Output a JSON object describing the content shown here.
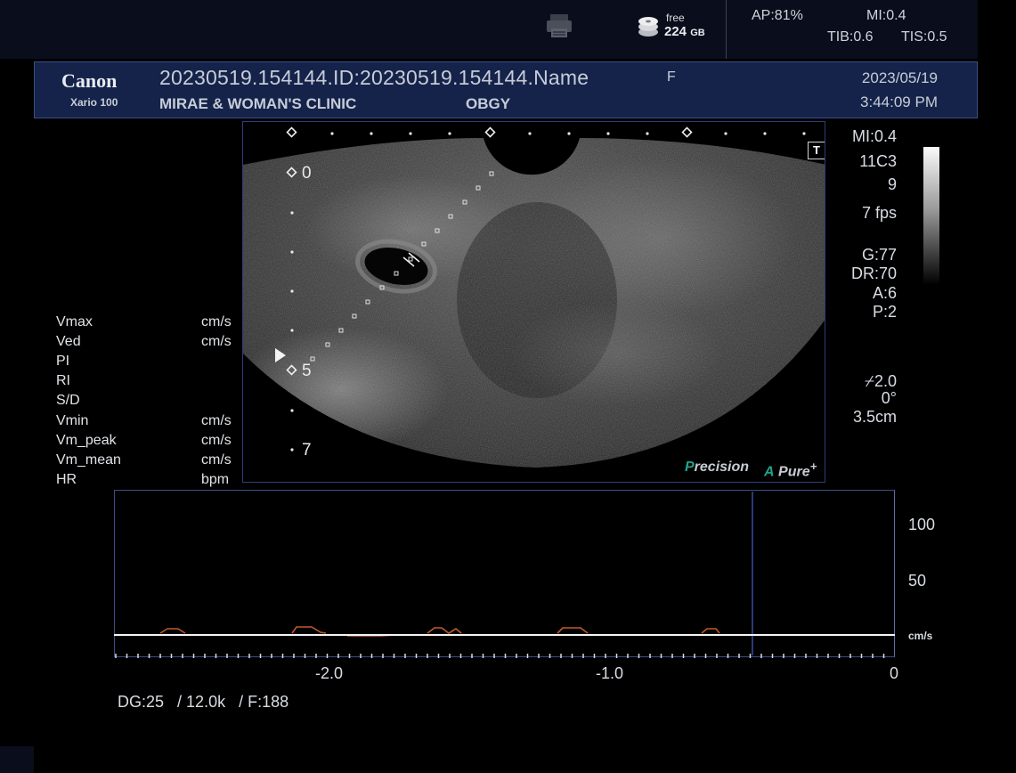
{
  "status": {
    "free_label": "free",
    "free_value": "224",
    "free_unit": "GB",
    "ap": "AP:81%",
    "mi": "MI:0.4",
    "tib": "TIB:0.6",
    "tis": "TIS:0.5",
    "printer_icon": "printer-icon",
    "disk_icon": "disk-icon"
  },
  "header": {
    "brand": "Canon",
    "model": "Xario 100",
    "patient_id": "20230519.154144.ID:20230519.154144.Name",
    "sex": "F",
    "clinic": "MIRAE & WOMAN'S CLINIC",
    "department": "OBGY",
    "date": "2023/05/19",
    "time": "3:44:09 PM"
  },
  "image": {
    "depth_labels": [
      "0",
      "5",
      "7"
    ],
    "t_marker": "T",
    "precision_prefix": "P",
    "precision_rest": "recision",
    "pure_prefix": "A",
    "pure_rest": "Pure",
    "pure_suffix": "+"
  },
  "right_params": {
    "mi": "MI:0.4",
    "probe": "11C3",
    "freq": "9",
    "fps": "7 fps",
    "gain": "G:77",
    "dr": "DR:70",
    "a": "A:6",
    "p": "P:2",
    "angle": "2.0",
    "angle_deg": "0°",
    "depth": "3.5cm"
  },
  "measurements": [
    {
      "label": "Vmax",
      "unit": "cm/s"
    },
    {
      "label": "Ved",
      "unit": "cm/s"
    },
    {
      "label": "PI",
      "unit": ""
    },
    {
      "label": "RI",
      "unit": ""
    },
    {
      "label": "S/D",
      "unit": ""
    },
    {
      "label": "Vmin",
      "unit": "cm/s"
    },
    {
      "label": "Vm_peak",
      "unit": "cm/s"
    },
    {
      "label": "Vm_mean",
      "unit": "cm/s"
    },
    {
      "label": "HR",
      "unit": "bpm"
    }
  ],
  "doppler": {
    "y_ticks": [
      "100",
      "50"
    ],
    "y_unit": "cm/s",
    "x_ticks": [
      "-2.0",
      "-1.0",
      "0"
    ],
    "dg": "DG:25",
    "prf": "/ 12.0k",
    "f": "/ F:188"
  },
  "colors": {
    "header_bg": "#15234a",
    "accent_green": "#1fa48b",
    "doppler_trace": "#c05a2a"
  }
}
